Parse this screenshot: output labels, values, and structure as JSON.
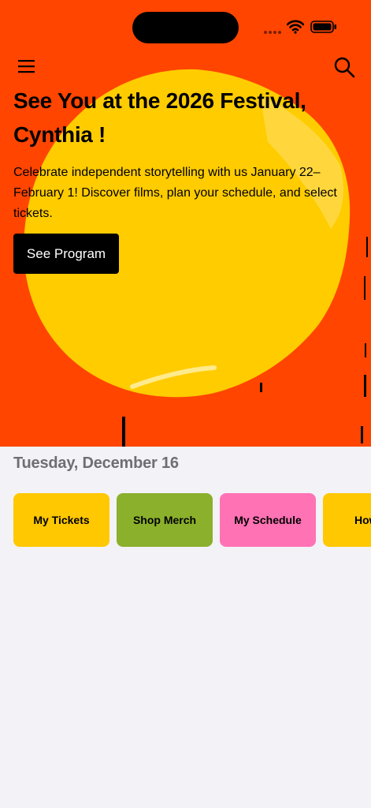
{
  "colors": {
    "hero_bg": "#FF4500",
    "sun": "#FFCC00",
    "page_bg": "#F2F2F7",
    "button_bg": "#000000"
  },
  "icons": {
    "menu": "hamburger-menu-icon",
    "search": "magnifier-search-icon",
    "wifi": "wifi-icon",
    "battery": "battery-icon"
  },
  "hero": {
    "title": "See You at the 2026 Festival, Cynthia !",
    "description": "Celebrate independent storytelling with us January 22–February 1! Discover films, plan your schedule, and select tickets.",
    "cta_label": "See Program"
  },
  "date_label": "Tuesday, December 16",
  "quick_actions": [
    {
      "label": "My Tickets",
      "color": "#FFC800"
    },
    {
      "label": "Shop Merch",
      "color": "#8BB02B"
    },
    {
      "label": "My Schedule",
      "color": "#FF72B4"
    },
    {
      "label": "How T",
      "color": "#FFC800"
    }
  ]
}
